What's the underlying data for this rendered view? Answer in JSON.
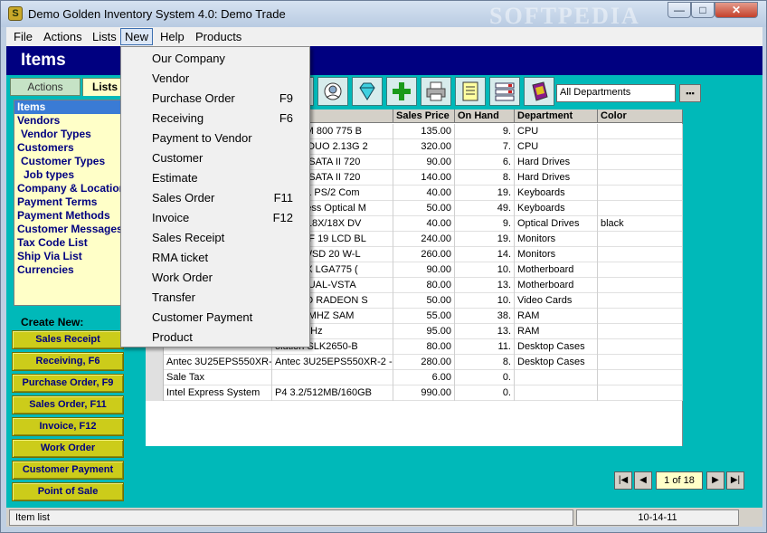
{
  "window": {
    "title": "Demo Golden Inventory System 4.0: Demo Trade",
    "watermark": "SOFTPEDIA",
    "controls": {
      "minimize": "—",
      "maximize": "□",
      "close": "✕"
    }
  },
  "menubar": {
    "file": "File",
    "actions": "Actions",
    "lists": "Lists",
    "new": "New",
    "help": "Help",
    "products": "Products"
  },
  "header": {
    "title": "Items"
  },
  "tabs": {
    "actions": "Actions",
    "lists": "Lists"
  },
  "lists_panel": {
    "items": [
      "Items",
      "Vendors",
      "Vendor Types",
      "Customers",
      "Customer Types",
      "Job types",
      "Company & Locations",
      "Payment Terms",
      "Payment Methods",
      "Customer Messages",
      "Tax Code List",
      "Ship Via List",
      "Currencies"
    ]
  },
  "create_new": {
    "label": "Create New:",
    "buttons": [
      "Sales Receipt",
      "Receiving, F6",
      "Purchase Order, F9",
      "Sales Order, F11",
      "Invoice, F12",
      "Work Order",
      "Customer Payment",
      "Point of Sale"
    ]
  },
  "toolbar": {
    "department_filter": "All Departments",
    "icons": [
      "vendor-icon",
      "diamond-icon",
      "add-icon",
      "print-icon",
      "report-icon",
      "list-view-icon",
      "book-icon"
    ]
  },
  "grid": {
    "columns": [
      "ption",
      "Sales Price",
      "On Hand",
      "Department",
      "Color"
    ],
    "rows": [
      {
        "name": "",
        "desc": "4 3.2 2M 800 775 B",
        "price": "135.00",
        "onhand": "9.",
        "dept": "CPU",
        "color": ""
      },
      {
        "name": "",
        "desc": "ORE 2 DUO 2.13G 2",
        "price": "320.00",
        "onhand": "7.",
        "dept": "CPU",
        "color": ""
      },
      {
        "name": "",
        "desc": "GB 3.5 SATA II 720",
        "price": "90.00",
        "onhand": "6.",
        "dept": "Hard Drives",
        "color": ""
      },
      {
        "name": "",
        "desc": "GB 3.5 SATA II 720",
        "price": "140.00",
        "onhand": "8.",
        "dept": "Hard Drives",
        "color": ""
      },
      {
        "name": "",
        "desc": "729-651 PS/2 Com",
        "price": "40.00",
        "onhand": "19.",
        "dept": "Keyboards",
        "color": ""
      },
      {
        "name": "",
        "desc": "n Wireless Optical M",
        "price": "50.00",
        "onhand": "49.",
        "dept": "Keyboards",
        "color": ""
      },
      {
        "name": "",
        "desc": "-H22N 18X/18X DV",
        "price": "40.00",
        "onhand": "9.",
        "dept": "Optical Drives",
        "color": "black"
      },
      {
        "name": "",
        "desc": "52TX-BF 19 LCD BL",
        "price": "240.00",
        "onhand": "19.",
        "dept": "Monitors",
        "color": ""
      },
      {
        "name": "",
        "desc": "L2016WSD 20 W-L",
        "price": "260.00",
        "onhand": "14.",
        "dept": "Monitors",
        "color": ""
      },
      {
        "name": "",
        "desc": "5GZ-MX LGA775 (",
        "price": "90.00",
        "onhand": "10.",
        "dept": "Motherboard",
        "color": ""
      },
      {
        "name": "",
        "desc": "K 775DUAL-VSTA",
        "price": "80.00",
        "onhand": "13.",
        "dept": "Motherboard",
        "color": ""
      },
      {
        "name": "",
        "desc": "9250/TD RADEON S",
        "price": "50.00",
        "onhand": "10.",
        "dept": "Video Cards",
        "color": ""
      },
      {
        "name": "",
        "desc": "2M 533MHZ SAM",
        "price": "55.00",
        "onhand": "38.",
        "dept": "RAM",
        "color": ""
      },
      {
        "name": "",
        "desc": "G 667MHz",
        "price": "95.00",
        "onhand": "13.",
        "dept": "RAM",
        "color": ""
      },
      {
        "name": "",
        "desc": "olution SLK2650-B",
        "price": "80.00",
        "onhand": "11.",
        "dept": "Desktop Cases",
        "color": ""
      },
      {
        "name": "Antec 3U25EPS550XR-2",
        "desc": "Antec 3U25EPS550XR-2 -",
        "price": "280.00",
        "onhand": "8.",
        "dept": "Desktop Cases",
        "color": ""
      },
      {
        "name": "Sale Tax",
        "desc": "",
        "price": "6.00",
        "onhand": "0.",
        "dept": "",
        "color": ""
      },
      {
        "name": "Intel Express System",
        "desc": "P4 3.2/512MB/160GB",
        "price": "990.00",
        "onhand": "0.",
        "dept": "",
        "color": ""
      }
    ]
  },
  "pager": {
    "info": "1 of 18"
  },
  "status": {
    "text": "Item list",
    "date": "10-14-11"
  },
  "new_menu": {
    "items": [
      {
        "label": "Our Company",
        "key": ""
      },
      {
        "label": "Vendor",
        "key": ""
      },
      {
        "label": "Purchase Order",
        "key": "F9"
      },
      {
        "label": "Receiving",
        "key": "F6"
      },
      {
        "label": "Payment to Vendor",
        "key": ""
      },
      {
        "label": "Customer",
        "key": ""
      },
      {
        "label": "Estimate",
        "key": ""
      },
      {
        "label": "Sales Order",
        "key": "F11"
      },
      {
        "label": "Invoice",
        "key": "F12"
      },
      {
        "label": "Sales Receipt",
        "key": ""
      },
      {
        "label": "RMA ticket",
        "key": ""
      },
      {
        "label": "Work Order",
        "key": ""
      },
      {
        "label": "Transfer",
        "key": ""
      },
      {
        "label": "Customer Payment",
        "key": ""
      },
      {
        "label": "Product",
        "key": ""
      }
    ]
  }
}
